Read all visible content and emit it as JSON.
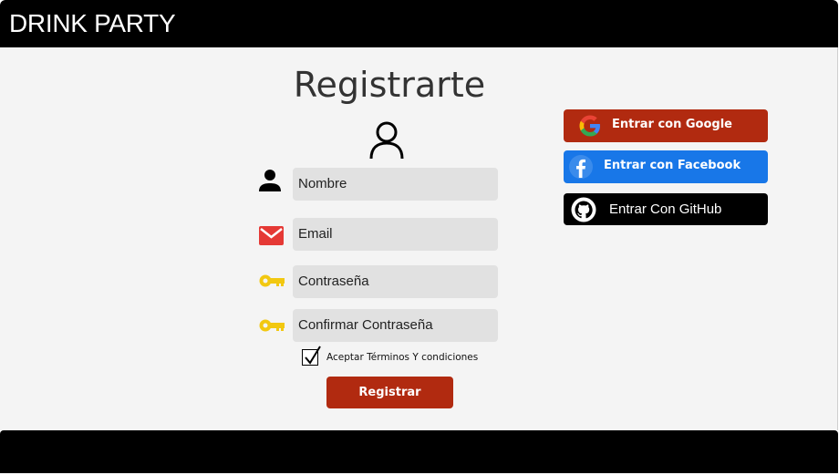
{
  "header": {
    "brand": "DRINK PARTY"
  },
  "form": {
    "title": "Registrarte",
    "name_placeholder": "Nombre",
    "email_placeholder": "Email",
    "password_placeholder": "Contraseña",
    "confirm_placeholder": "Confirmar Contraseña",
    "terms_label": "Aceptar Términos Y condiciones",
    "terms_checked": true,
    "submit_label": "Registrar"
  },
  "social": {
    "google_label": "Entrar con Google",
    "facebook_label": "Entrar con Facebook",
    "github_label": "Entrar Con GitHub"
  },
  "colors": {
    "header_bg": "#000000",
    "content_bg": "#f4f4f4",
    "field_bg": "#e1e1e1",
    "primary_red": "#b12a10",
    "facebook_blue": "#1877e8",
    "key_yellow": "#f2c811",
    "mail_red": "#e53935"
  },
  "icons": {
    "avatar": "user-outline-icon",
    "name": "person-icon",
    "email": "mail-icon",
    "password": "key-icon",
    "confirm": "key-icon",
    "google": "google-icon",
    "facebook": "facebook-icon",
    "github": "github-icon"
  }
}
